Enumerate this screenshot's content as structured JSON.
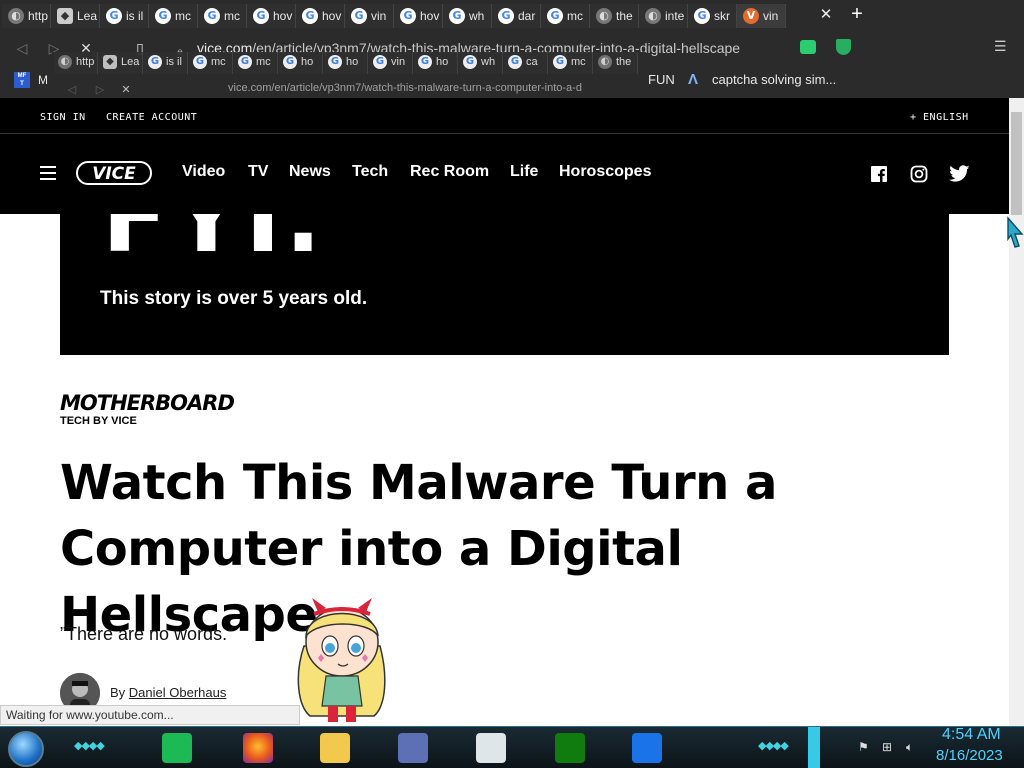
{
  "browser": {
    "tabs": [
      {
        "label": "http",
        "icon": "globe-icon"
      },
      {
        "label": "Lea",
        "icon": "roblox-icon"
      },
      {
        "label": "is il",
        "icon": "google-icon"
      },
      {
        "label": "mc",
        "icon": "google-icon"
      },
      {
        "label": "mc",
        "icon": "google-icon"
      },
      {
        "label": "hov",
        "icon": "google-icon"
      },
      {
        "label": "hov",
        "icon": "google-icon"
      },
      {
        "label": "vin",
        "icon": "google-icon"
      },
      {
        "label": "hov",
        "icon": "google-icon"
      },
      {
        "label": "wh",
        "icon": "google-icon"
      },
      {
        "label": "dar",
        "icon": "google-icon"
      },
      {
        "label": "mc",
        "icon": "google-icon"
      },
      {
        "label": "the",
        "icon": "globe-icon"
      },
      {
        "label": "inte",
        "icon": "globe-icon"
      },
      {
        "label": "skr",
        "icon": "google-icon"
      },
      {
        "label": "vin",
        "icon": "vice-icon"
      }
    ],
    "url_host": "vice.com",
    "url_path": "/en/article/vp3nm7/watch-this-malware-turn-a-computer-into-a-digital-hellscape",
    "bookmarks": {
      "first": "M",
      "fun": "FUN",
      "captcha": "captcha solving sim..."
    },
    "ghost_tabs": [
      {
        "label": "http"
      },
      {
        "label": "Lea"
      },
      {
        "label": "is il"
      },
      {
        "label": "mc"
      },
      {
        "label": "mc"
      },
      {
        "label": "ho"
      },
      {
        "label": "ho"
      },
      {
        "label": "vin"
      },
      {
        "label": "ho"
      },
      {
        "label": "wh"
      },
      {
        "label": "ca"
      },
      {
        "label": "mc"
      },
      {
        "label": "the"
      }
    ],
    "ghost_url": "vice.com/en/article/vp3nm7/watch-this-malware-turn-a-computer-into-a-d",
    "status": "Waiting for www.youtube.com..."
  },
  "site": {
    "util": {
      "sign_in": "SIGN IN",
      "create_account": "CREATE ACCOUNT",
      "language": "+ ENGLISH"
    },
    "logo": "VICE",
    "nav": [
      "Video",
      "TV",
      "News",
      "Tech",
      "Rec Room",
      "Life",
      "Horoscopes"
    ],
    "hero": {
      "fyi": "FYI.",
      "notice": "This story is over 5 years old."
    },
    "brand": "MOTHERBOARD",
    "brand_sub": "TECH BY VICE",
    "headline": "Watch This Malware Turn a Computer into a Digital Hellscape",
    "dek": "”There are no words.”",
    "byline_prefix": "By",
    "author": "Daniel Oberhaus"
  },
  "taskbar": {
    "time": "4:54 AM",
    "date": "8/16/2023"
  },
  "colors": {
    "accent_clock": "#4fd0ff",
    "nav_bg": "#000000"
  }
}
